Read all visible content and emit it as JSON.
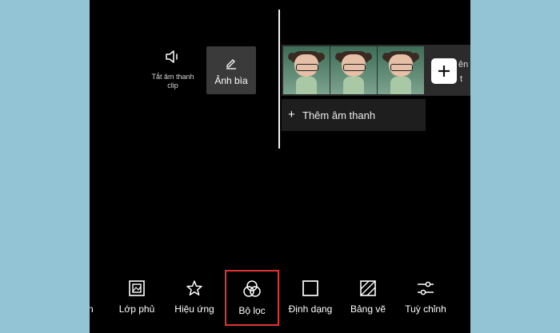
{
  "timeline": {
    "mute_clip_label_line1": "Tắt âm thanh",
    "mute_clip_label_line2": "clip",
    "cover_label": "Ảnh bìa",
    "add_audio_label": "Thêm âm thanh",
    "side_label_partial_1": "ên",
    "side_label_partial_2": "t"
  },
  "toolbar": {
    "items": [
      {
        "label": "án",
        "icon": "partial-icon"
      },
      {
        "label": "Lớp phủ",
        "icon": "overlay-icon"
      },
      {
        "label": "Hiệu ứng",
        "icon": "effects-star-icon"
      },
      {
        "label": "Bộ lọc",
        "icon": "filter-circles-icon",
        "highlighted": true
      },
      {
        "label": "Định dạng",
        "icon": "format-square-icon"
      },
      {
        "label": "Bảng vẽ",
        "icon": "canvas-hatch-icon"
      },
      {
        "label": "Tuỳ chỉnh",
        "icon": "adjust-sliders-icon"
      }
    ]
  },
  "colors": {
    "page_background": "#93c4d6",
    "app_background": "#000000",
    "highlight_border": "#e23434"
  }
}
